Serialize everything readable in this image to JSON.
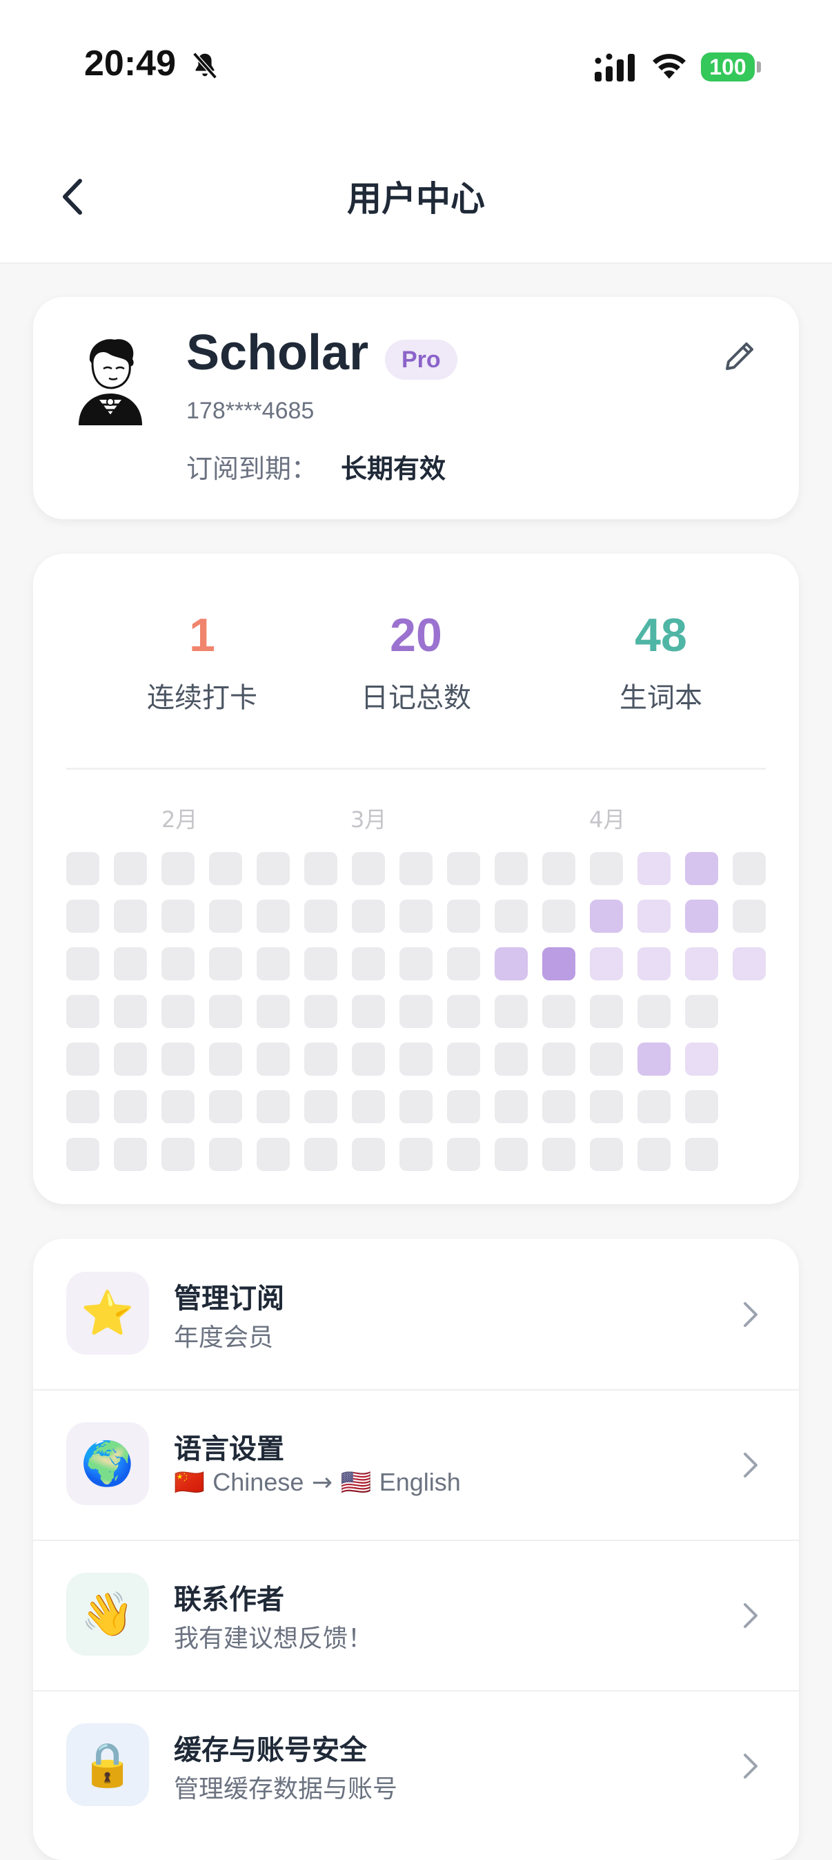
{
  "status_bar": {
    "time": "20:49",
    "battery": "100"
  },
  "header": {
    "title": "用户中心"
  },
  "profile": {
    "name": "Scholar",
    "badge": "Pro",
    "phone": "178****4685",
    "subscription_label": "订阅到期：",
    "subscription_value": "长期有效"
  },
  "stats": [
    {
      "value": "1",
      "label": "连续打卡",
      "color": "#f0846c"
    },
    {
      "value": "20",
      "label": "日记总数",
      "color": "#9b72cf"
    },
    {
      "value": "48",
      "label": "生词本",
      "color": "#4fb5a5"
    }
  ],
  "heatmap": {
    "months": [
      "2月",
      "3月",
      "4月"
    ],
    "colors": {
      "0": "#ebebee",
      "1": "#e8ddf4",
      "2": "#d6c3ee",
      "3": "#bb9de3"
    },
    "grid": [
      [
        0,
        0,
        0,
        0,
        0,
        0,
        0,
        0,
        0,
        0,
        0,
        0,
        1,
        2,
        0
      ],
      [
        0,
        0,
        0,
        0,
        0,
        0,
        0,
        0,
        0,
        0,
        0,
        2,
        1,
        2,
        0
      ],
      [
        0,
        0,
        0,
        0,
        0,
        0,
        0,
        0,
        0,
        2,
        3,
        1,
        1,
        1,
        1
      ],
      [
        0,
        0,
        0,
        0,
        0,
        0,
        0,
        0,
        0,
        0,
        0,
        0,
        0,
        0,
        null
      ],
      [
        0,
        0,
        0,
        0,
        0,
        0,
        0,
        0,
        0,
        0,
        0,
        0,
        2,
        1,
        null
      ],
      [
        0,
        0,
        0,
        0,
        0,
        0,
        0,
        0,
        0,
        0,
        0,
        0,
        0,
        0,
        null
      ],
      [
        0,
        0,
        0,
        0,
        0,
        0,
        0,
        0,
        0,
        0,
        0,
        0,
        0,
        0,
        null
      ]
    ]
  },
  "menu": [
    {
      "icon": "star-icon",
      "emoji": "⭐",
      "bg": "#f3f0f8",
      "title": "管理订阅",
      "subtitle": "年度会员"
    },
    {
      "icon": "globe-icon",
      "emoji": "🌍",
      "bg": "#f3f0f8",
      "title": "语言设置",
      "flag_from": "🇨🇳",
      "lang_from": "Chinese",
      "arrow": "→",
      "flag_to": "🇺🇸",
      "lang_to": "English"
    },
    {
      "icon": "waving-hand-icon",
      "emoji": "👋",
      "bg": "#ecf6f3",
      "title": "联系作者",
      "subtitle": "我有建议想反馈！"
    },
    {
      "icon": "lock-icon",
      "emoji": "🔒",
      "bg": "#eaf1fb",
      "title": "缓存与账号安全",
      "subtitle": "管理缓存数据与账号"
    }
  ]
}
